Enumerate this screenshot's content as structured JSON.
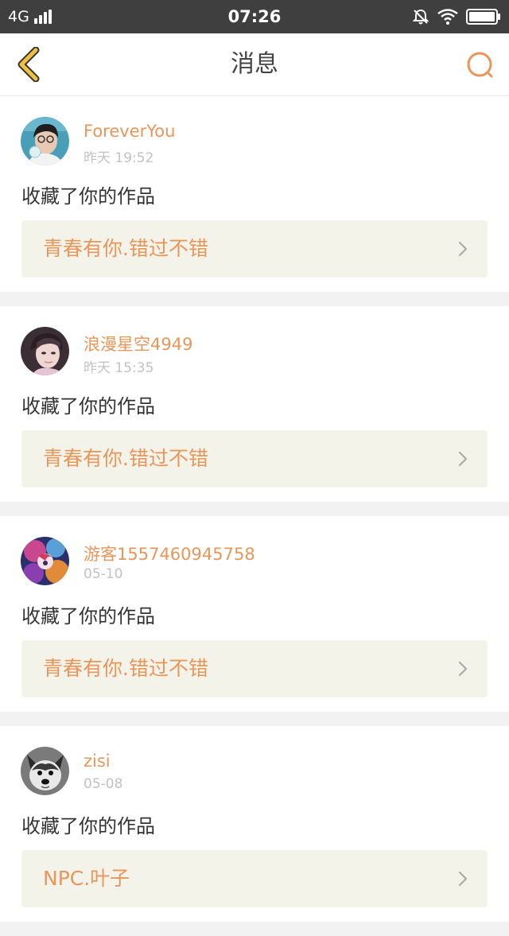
{
  "status_bar": {
    "network": "4G",
    "time": "07:26",
    "icons": [
      "signal-icon",
      "bell-muted-icon",
      "wifi-icon",
      "battery-icon"
    ]
  },
  "nav": {
    "title": "消息",
    "back_icon": "chevron-left-icon",
    "search_icon": "search-icon"
  },
  "colors": {
    "accent": "#e8965a",
    "back_arrow": "#f0c040",
    "card_link_bg": "#f4f3ea",
    "status_bar_bg": "#3f3f3f"
  },
  "messages": [
    {
      "user": "ForeverYou",
      "time": "昨天 19:52",
      "action": "收藏了你的作品",
      "work": "青春有你.错过不错"
    },
    {
      "user": "浪漫星空4949",
      "time": "昨天 15:35",
      "action": "收藏了你的作品",
      "work": "青春有你.错过不错"
    },
    {
      "user": "游客1557460945758",
      "time": "05-10",
      "action": "收藏了你的作品",
      "work": "青春有你.错过不错"
    },
    {
      "user": "zisi",
      "time": "05-08",
      "action": "收藏了你的作品",
      "work": "NPC.叶子"
    }
  ]
}
